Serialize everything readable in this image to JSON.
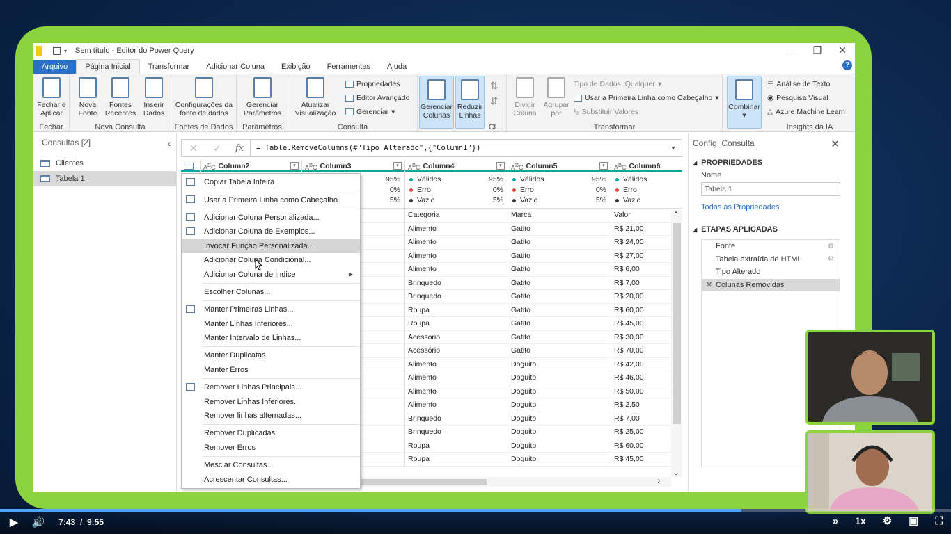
{
  "window": {
    "title": "Sem título - Editor do Power Query"
  },
  "tabs": [
    "Arquivo",
    "Página Inicial",
    "Transformar",
    "Adicionar Coluna",
    "Exibição",
    "Ferramentas",
    "Ajuda"
  ],
  "ribbon": {
    "fechar_aplicar": "Fechar e\nAplicar",
    "fechar_group": "Fechar",
    "nova_fonte": "Nova\nFonte",
    "fontes_recentes": "Fontes\nRecentes",
    "inserir_dados": "Inserir\nDados",
    "nova_consulta_group": "Nova Consulta",
    "config_fonte": "Configurações da\nfonte de dados",
    "fontes_dados_group": "Fontes de Dados",
    "gerenciar_param": "Gerenciar\nParâmetros",
    "parametros_group": "Parâmetros",
    "atualizar": "Atualizar\nVisualização",
    "propriedades": "Propriedades",
    "editor_avancado": "Editor Avançado",
    "gerenciar": "Gerenciar",
    "consulta_group": "Consulta",
    "gerenciar_colunas": "Gerenciar\nColunas",
    "reduzir_linhas": "Reduzir\nLinhas",
    "cl_group": "Cl...",
    "dividir_coluna": "Dividir\nColuna",
    "agrupar_por": "Agrupar\npor",
    "tipo_dados": "Tipo de Dados: Qualquer",
    "primeira_linha": "Usar a Primeira Linha como Cabeçalho",
    "substituir": "Substituir Valores",
    "transformar_group": "Transformar",
    "combinar": "Combinar",
    "analise_texto": "Análise de Texto",
    "pesquisa_visual": "Pesquisa Visual",
    "azure_ml": "Azure Machine Learn",
    "insights_group": "Insights da IA"
  },
  "queries": {
    "header": "Consultas [2]",
    "items": [
      "Clientes",
      "Tabela 1"
    ]
  },
  "formula": "= Table.RemoveColumns(#\"Tipo Alterado\",{\"Column1\"})",
  "columns": [
    "Column2",
    "Column3",
    "Column4",
    "Column5",
    "Column6"
  ],
  "quality": {
    "valid_label": "Válidos",
    "error_label": "Erro",
    "empty_label": "Vazio",
    "valid": "95%",
    "error": "0%",
    "empty": "5%"
  },
  "rows": [
    [
      "",
      "",
      "Categoria",
      "Marca",
      "Valor"
    ],
    [
      "",
      "",
      "Alimento",
      "Gatito",
      "R$ 21,00"
    ],
    [
      "",
      "",
      "Alimento",
      "Gatito",
      "R$ 24,00"
    ],
    [
      "",
      "",
      "Alimento",
      "Gatito",
      "R$ 27,00"
    ],
    [
      "",
      "",
      "Alimento",
      "Gatito",
      "R$ 6,00"
    ],
    [
      "",
      "",
      "Brinquedo",
      "Gatito",
      "R$ 7,00"
    ],
    [
      "",
      "",
      "Brinquedo",
      "Gatito",
      "R$ 20,00"
    ],
    [
      "",
      "",
      "Roupa",
      "Gatito",
      "R$ 60,00"
    ],
    [
      "",
      "",
      "Roupa",
      "Gatito",
      "R$ 45,00"
    ],
    [
      "",
      "",
      "Acessório",
      "Gatito",
      "R$ 30,00"
    ],
    [
      "",
      "",
      "Acessório",
      "Gatito",
      "R$ 70,00"
    ],
    [
      "",
      "",
      "Alimento",
      "Doguito",
      "R$ 42,00"
    ],
    [
      "",
      "",
      "Alimento",
      "Doguito",
      "R$ 46,00"
    ],
    [
      "",
      "",
      "Alimento",
      "Doguito",
      "R$ 50,00"
    ],
    [
      "",
      "",
      "Alimento",
      "Doguito",
      "R$ 2,50"
    ],
    [
      "",
      "",
      "Brinquedo",
      "Doguito",
      "R$ 7,00"
    ],
    [
      "",
      "",
      "Brinquedo",
      "Doguito",
      "R$ 25,00"
    ],
    [
      "",
      "",
      "Roupa",
      "Doguito",
      "R$ 60,00"
    ],
    [
      "",
      "",
      "Roupa",
      "Doguito",
      "R$ 45,00"
    ]
  ],
  "context_menu": [
    {
      "label": "Copiar Tabela Inteira",
      "icon": true
    },
    {
      "sep": true
    },
    {
      "label": "Usar a Primeira Linha como Cabeçalho",
      "icon": true
    },
    {
      "sep": true
    },
    {
      "label": "Adicionar Coluna Personalizada...",
      "icon": true
    },
    {
      "label": "Adicionar Coluna de Exemplos...",
      "icon": true
    },
    {
      "label": "Invocar Função Personalizada...",
      "highlight": true
    },
    {
      "label": "Adicionar Coluna Condicional..."
    },
    {
      "label": "Adicionar Coluna de Índice",
      "submenu": true
    },
    {
      "sep": true
    },
    {
      "label": "Escolher Colunas..."
    },
    {
      "sep": true
    },
    {
      "label": "Manter Primeiras Linhas...",
      "icon": true
    },
    {
      "label": "Manter Linhas Inferiores..."
    },
    {
      "label": "Manter Intervalo de Linhas..."
    },
    {
      "sep": true
    },
    {
      "label": "Manter Duplicatas"
    },
    {
      "label": "Manter Erros"
    },
    {
      "sep": true
    },
    {
      "label": "Remover Linhas Principais...",
      "icon": true
    },
    {
      "label": "Remover Linhas Inferiores..."
    },
    {
      "label": "Remover linhas alternadas..."
    },
    {
      "sep": true
    },
    {
      "label": "Remover Duplicadas"
    },
    {
      "label": "Remover Erros"
    },
    {
      "sep": true
    },
    {
      "label": "Mesclar Consultas..."
    },
    {
      "label": "Acrescentar Consultas..."
    }
  ],
  "settings": {
    "header": "Config. Consulta",
    "props": "PROPRIEDADES",
    "name_label": "Nome",
    "name_value": "Tabela 1",
    "all_props": "Todas as Propriedades",
    "steps_header": "ETAPAS APLICADAS",
    "steps": [
      {
        "label": "Fonte",
        "gear": true
      },
      {
        "label": "Tabela extraída de HTML",
        "gear": true
      },
      {
        "label": "Tipo Alterado"
      },
      {
        "label": "Colunas Removidas",
        "selected": true
      }
    ]
  },
  "player": {
    "current": "7:43",
    "separator": "/",
    "total": "9:55",
    "speed": "1x",
    "progress": 0.78
  },
  "colors": {
    "accent": "#2b6fc7",
    "frame": "#8cd43f",
    "teal": "#00a99d",
    "valid": "#00a99d",
    "error": "#e04b4b",
    "empty": "#333333"
  }
}
